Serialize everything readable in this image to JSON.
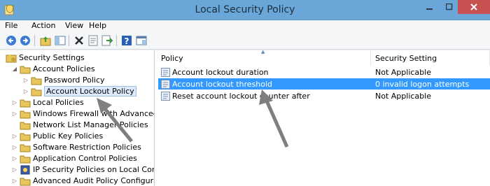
{
  "window": {
    "title": "Local Security Policy",
    "titlebar_color": "#6aa7d8",
    "close_color": "#c75050"
  },
  "menu": [
    "File",
    "Action",
    "View",
    "Help"
  ],
  "toolbar": {
    "buttons": [
      "back-icon",
      "forward-icon",
      "up-folder-icon",
      "show-hide-tree-icon",
      "delete-icon",
      "properties-icon",
      "export-list-icon",
      "help-icon",
      "console-icon"
    ]
  },
  "tree": {
    "root": "Security Settings",
    "items": [
      {
        "label": "Account Policies",
        "expanded": true
      },
      {
        "label": "Password Policy"
      },
      {
        "label": "Account Lockout Policy",
        "selected": true
      },
      {
        "label": "Local Policies"
      },
      {
        "label": "Windows Firewall with Advanced Secu"
      },
      {
        "label": "Network List Manager Policies"
      },
      {
        "label": "Public Key Policies"
      },
      {
        "label": "Software Restriction Policies"
      },
      {
        "label": "Application Control Policies"
      },
      {
        "label": "IP Security Policies on Local Compute"
      },
      {
        "label": "Advanced Audit Policy Configuration"
      }
    ]
  },
  "list": {
    "columns": [
      "Policy",
      "Security Setting"
    ],
    "rows": [
      {
        "policy": "Account lockout duration",
        "setting": "Not Applicable"
      },
      {
        "policy": "Account lockout threshold",
        "setting": "0 invalid logon attempts",
        "selected": true
      },
      {
        "policy": "Reset account lockout counter after",
        "setting": "Not Applicable"
      }
    ],
    "selection_color": "#3399ff"
  }
}
